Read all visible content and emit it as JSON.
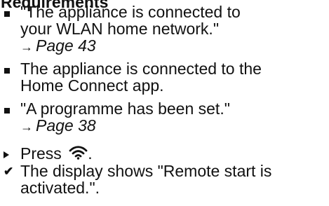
{
  "heading": "Requirements",
  "requirements": [
    {
      "text_lines": [
        "\"The appliance is connected to",
        "your WLAN home network.\""
      ],
      "page_ref": "Page 43"
    },
    {
      "text_lines": [
        "The appliance is connected to the",
        "Home Connect app."
      ]
    },
    {
      "text_lines": [
        "\"A programme has been set.\""
      ],
      "page_ref": "Page 38"
    }
  ],
  "page_ref_arrow": "→",
  "step": {
    "prefix": "Press",
    "icon": "wifi-remote-start-icon",
    "suffix": "."
  },
  "result": {
    "marker": "✔",
    "text_lines": [
      "The display shows \"Remote start is",
      "activated.\"."
    ]
  }
}
